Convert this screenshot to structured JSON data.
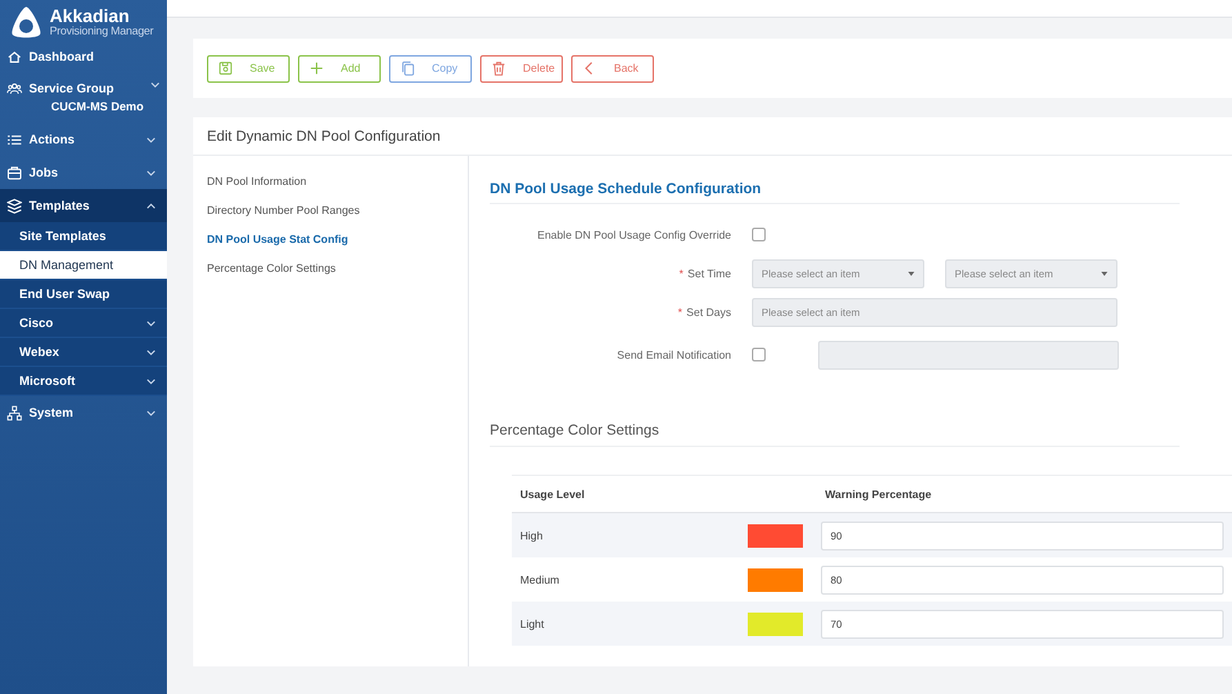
{
  "sidebar": {
    "brand": {
      "name": "Akkadian",
      "subtitle": "Provisioning Manager"
    },
    "items": [
      {
        "label": "Dashboard",
        "selected": false
      },
      {
        "label": "Service Group",
        "subtitle": "CUCM-MS Demo",
        "expanded": false,
        "selected": false
      },
      {
        "label": "Actions",
        "expanded": false,
        "selected": false
      },
      {
        "label": "Jobs",
        "expanded": false,
        "selected": false
      },
      {
        "label": "Templates",
        "expanded": true,
        "selected": false,
        "children": [
          {
            "label": "Site Templates",
            "selected": false
          },
          {
            "label": "DN Management",
            "selected": true
          },
          {
            "label": "End User Swap",
            "selected": false
          },
          {
            "label": "Cisco",
            "expanded": false,
            "selected": false
          },
          {
            "label": "Webex",
            "expanded": false,
            "selected": false
          },
          {
            "label": "Microsoft",
            "expanded": false,
            "selected": false
          }
        ]
      },
      {
        "label": "System",
        "expanded": false,
        "selected": false
      }
    ]
  },
  "toolbar": {
    "buttons": [
      {
        "label": "Save",
        "color": "#8bc34a"
      },
      {
        "label": "Add",
        "color": "#8bc34a"
      },
      {
        "label": "Copy",
        "color": "#7ea6e0"
      },
      {
        "label": "Delete",
        "color": "#e57368"
      },
      {
        "label": "Back",
        "color": "#e57368"
      }
    ]
  },
  "panel": {
    "title": "Edit Dynamic DN Pool Configuration",
    "nav": [
      {
        "label": "DN Pool Information",
        "selected": false
      },
      {
        "label": "Directory Number Pool Ranges",
        "selected": false
      },
      {
        "label": "DN Pool Usage Stat Config",
        "selected": true
      },
      {
        "label": "Percentage Color Settings",
        "selected": false
      }
    ],
    "schedule": {
      "title": "DN Pool Usage Schedule Configuration",
      "fields": [
        {
          "kind": "checkbox",
          "label": "Enable DN Pool Usage Config Override",
          "checked": false
        },
        {
          "kind": "select-pair",
          "label": "Set Time",
          "marker": "*",
          "placeholders": [
            "Please select an item",
            "Please select an item"
          ]
        },
        {
          "kind": "select",
          "label": "Set Days",
          "marker": "*",
          "placeholder": "Please select an item"
        },
        {
          "kind": "checkbox-field",
          "label": "Send Email Notification",
          "checked": false
        }
      ]
    },
    "colors": {
      "title": "Percentage Color Settings",
      "columns": [
        "Usage Level",
        "Warning Percentage"
      ],
      "rows": [
        {
          "level": "High",
          "color": "#ff4b33",
          "value": "90"
        },
        {
          "level": "Medium",
          "color": "#ff7b00",
          "value": "80"
        },
        {
          "level": "Light",
          "color": "#e2ea2a",
          "value": "70"
        }
      ]
    }
  }
}
